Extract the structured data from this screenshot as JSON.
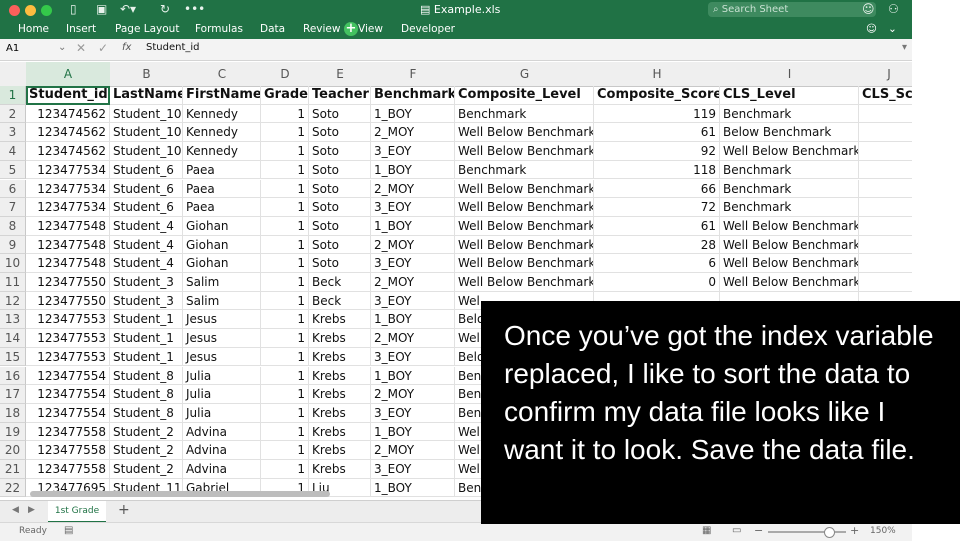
{
  "window": {
    "title": "Example.xls",
    "search_placeholder": "Search Sheet",
    "traffic_colors": [
      "#fc605b",
      "#fdbc40",
      "#34c84a"
    ]
  },
  "ribbon_tabs": [
    "Home",
    "Insert",
    "Page Layout",
    "Formulas",
    "Data",
    "Review",
    "View",
    "Developer"
  ],
  "formula_bar": {
    "cell_ref": "A1",
    "fx": "fx",
    "content": "Student_id"
  },
  "column_letters": [
    "A",
    "B",
    "C",
    "D",
    "E",
    "F",
    "G",
    "H",
    "I",
    "J"
  ],
  "table": {
    "headers": [
      "Student_id",
      "LastName",
      "FirstName",
      "Grade",
      "Teacher",
      "Benchmark",
      "Composite_Level",
      "Composite_Score",
      "CLS_Level",
      "CLS_Sco"
    ],
    "rows": [
      [
        "123474562",
        "Student_10",
        "Kennedy",
        "1",
        "Soto",
        "1_BOY",
        "Benchmark",
        "119",
        "Benchmark",
        ""
      ],
      [
        "123474562",
        "Student_10",
        "Kennedy",
        "1",
        "Soto",
        "2_MOY",
        "Well Below Benchmark",
        "61",
        "Below Benchmark",
        ""
      ],
      [
        "123474562",
        "Student_10",
        "Kennedy",
        "1",
        "Soto",
        "3_EOY",
        "Well Below Benchmark",
        "92",
        "Well Below Benchmark",
        ""
      ],
      [
        "123477534",
        "Student_6",
        "Paea",
        "1",
        "Soto",
        "1_BOY",
        "Benchmark",
        "118",
        "Benchmark",
        ""
      ],
      [
        "123477534",
        "Student_6",
        "Paea",
        "1",
        "Soto",
        "2_MOY",
        "Well Below Benchmark",
        "66",
        "Benchmark",
        ""
      ],
      [
        "123477534",
        "Student_6",
        "Paea",
        "1",
        "Soto",
        "3_EOY",
        "Well Below Benchmark",
        "72",
        "Benchmark",
        ""
      ],
      [
        "123477548",
        "Student_4",
        "Giohan",
        "1",
        "Soto",
        "1_BOY",
        "Well Below Benchmark",
        "61",
        "Well Below Benchmark",
        ""
      ],
      [
        "123477548",
        "Student_4",
        "Giohan",
        "1",
        "Soto",
        "2_MOY",
        "Well Below Benchmark",
        "28",
        "Well Below Benchmark",
        ""
      ],
      [
        "123477548",
        "Student_4",
        "Giohan",
        "1",
        "Soto",
        "3_EOY",
        "Well Below Benchmark",
        "6",
        "Well Below Benchmark",
        ""
      ],
      [
        "123477550",
        "Student_3",
        "Salim",
        "1",
        "Beck",
        "2_MOY",
        "Well Below Benchmark",
        "0",
        "Well Below Benchmark",
        ""
      ],
      [
        "123477550",
        "Student_3",
        "Salim",
        "1",
        "Beck",
        "3_EOY",
        "Wel",
        "",
        "",
        ""
      ],
      [
        "123477553",
        "Student_1",
        "Jesus",
        "1",
        "Krebs",
        "1_BOY",
        "Belo",
        "",
        "",
        ""
      ],
      [
        "123477553",
        "Student_1",
        "Jesus",
        "1",
        "Krebs",
        "2_MOY",
        "Wel",
        "",
        "",
        ""
      ],
      [
        "123477553",
        "Student_1",
        "Jesus",
        "1",
        "Krebs",
        "3_EOY",
        "Belo",
        "",
        "",
        ""
      ],
      [
        "123477554",
        "Student_8",
        "Julia",
        "1",
        "Krebs",
        "1_BOY",
        "Ben",
        "",
        "",
        ""
      ],
      [
        "123477554",
        "Student_8",
        "Julia",
        "1",
        "Krebs",
        "2_MOY",
        "Ben",
        "",
        "",
        ""
      ],
      [
        "123477554",
        "Student_8",
        "Julia",
        "1",
        "Krebs",
        "3_EOY",
        "Ben",
        "",
        "",
        ""
      ],
      [
        "123477558",
        "Student_2",
        "Advina",
        "1",
        "Krebs",
        "1_BOY",
        "Wel",
        "",
        "",
        ""
      ],
      [
        "123477558",
        "Student_2",
        "Advina",
        "1",
        "Krebs",
        "2_MOY",
        "Wel",
        "",
        "",
        ""
      ],
      [
        "123477558",
        "Student_2",
        "Advina",
        "1",
        "Krebs",
        "3_EOY",
        "Wel",
        "",
        "",
        ""
      ],
      [
        "123477695",
        "Student_11",
        "Gabriel",
        "1",
        "Liu",
        "1_BOY",
        "Ben",
        "",
        "",
        ""
      ]
    ]
  },
  "sheet_tabs": [
    "1st Grade"
  ],
  "add_sheet": "+",
  "status": {
    "ready": "Ready",
    "zoom": "150%",
    "zoom_fraction": 0.78
  },
  "caption": "Once you’ve got the index variable replaced, I like to sort the data to confirm my data file looks like I want it to look. Save the data file."
}
